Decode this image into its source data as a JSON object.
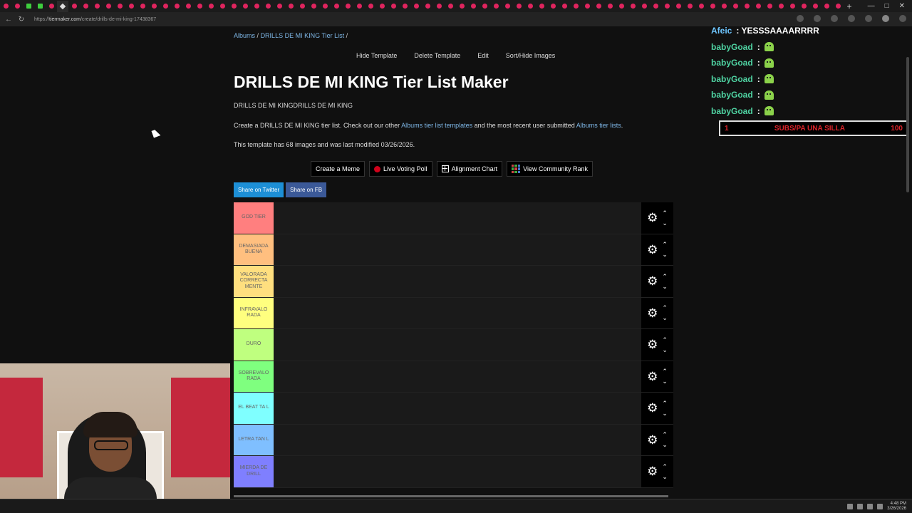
{
  "browser": {
    "url_host": "tiermaker.com",
    "url_path": "/create/drills-de-mi-king-17438367",
    "url_prefix": "https://"
  },
  "breadcrumb": {
    "items": [
      "Albums",
      "DRILLS DE MI KING Tier List"
    ],
    "separator": "/"
  },
  "topnav": {
    "hide_template": "Hide Template",
    "delete_template": "Delete Template",
    "edit": "Edit",
    "sort_hide": "Sort/Hide Images"
  },
  "title": "DRILLS DE MI KING Tier List Maker",
  "subtitle": "DRILLS DE MI KINGDRILLS DE MI KING",
  "description": {
    "pre": "Create a DRILLS DE MI KING tier list. Check out our other ",
    "link1": "Albums tier list templates",
    "mid": " and the most recent user submitted ",
    "link2": "Albums tier lists",
    "post": "."
  },
  "meta": "This template has 68 images and was last modified 03/26/2026.",
  "actions": {
    "meme": "Create a Meme",
    "poll": "Live Voting Poll",
    "alignment": "Alignment Chart",
    "community": "View Community Rank"
  },
  "share": {
    "twitter": "Share on Twitter",
    "fb": "Share on FB"
  },
  "tiers": [
    {
      "label": "GOD TIER",
      "color": "#ff7f7f"
    },
    {
      "label": "DEMASIADA BUENA",
      "color": "#ffbf7f"
    },
    {
      "label": "VALORADA CORRECTA MENTE",
      "color": "#ffdf7f"
    },
    {
      "label": "INFRAVALO RADA",
      "color": "#ffff7f"
    },
    {
      "label": "DURO",
      "color": "#bfff7f"
    },
    {
      "label": "SOBREVALO RADA",
      "color": "#7fff7f"
    },
    {
      "label": "EL BEAT TA L",
      "color": "#7fffff"
    },
    {
      "label": "LETRA TAN L",
      "color": "#7fbfff"
    },
    {
      "label": "MIERDA DE DRILL",
      "color": "#7f7fff"
    }
  ],
  "chat": [
    {
      "user": "Afeic",
      "msg": ": YESSSAAAARRRR",
      "user_color": "blue"
    },
    {
      "user": "babyGoad",
      "msg": ":",
      "emote": "ghost-emote"
    },
    {
      "user": "babyGoad",
      "msg": ":",
      "emote": "ghost-emote"
    },
    {
      "user": "babyGoad",
      "msg": ":",
      "emote": "ghost-emote"
    },
    {
      "user": "babyGoad",
      "msg": ":",
      "emote": "ghost-emote"
    },
    {
      "user": "babyGoad",
      "msg": ":",
      "emote": "ghost-emote"
    }
  ],
  "subs_goal": {
    "current": "1",
    "label": "SUBS/PA UNA SILLA",
    "target": "100"
  },
  "taskbar": {
    "time": "4:48 PM",
    "date": "3/26/2026"
  }
}
